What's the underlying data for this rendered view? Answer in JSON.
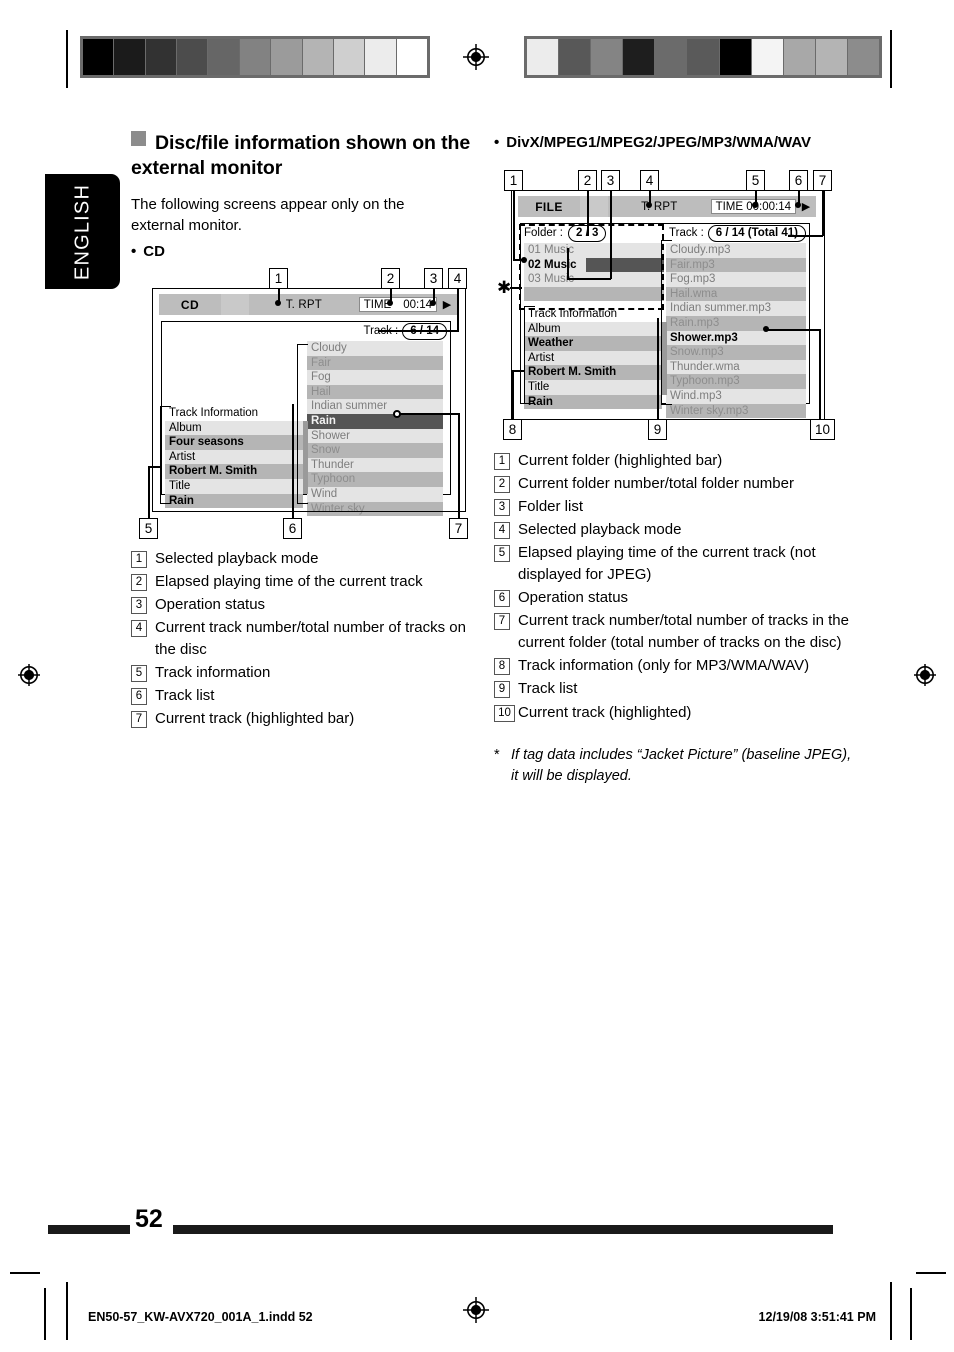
{
  "page": {
    "language_tab": "ENGLISH",
    "number": "52",
    "footer_file": "EN50-57_KW-AVX720_001A_1.indd   52",
    "footer_date": "12/19/08   3:51:41 PM"
  },
  "section": {
    "title": "Disc/file information shown on the external monitor",
    "intro": "The following screens appear only on the external monitor.",
    "cd_label": "CD",
    "divx_label": "DivX/MPEG1/MPEG2/JPEG/MP3/WMA/WAV",
    "bullet": "•"
  },
  "cd_screen": {
    "source": "CD",
    "mode": "T. RPT",
    "time_label": "TIME",
    "time_value": "00:14",
    "play_icon": "▶",
    "track_label": "Track :",
    "track_value": "6 / 14",
    "info_title": "Track Information",
    "info_rows": [
      {
        "key": "Album",
        "value": "Four seasons"
      },
      {
        "key": "Artist",
        "value": "Robert M. Smith"
      },
      {
        "key": "Title",
        "value": "Rain"
      }
    ],
    "tracks": [
      "Cloudy",
      "Fair",
      "Fog",
      "Hail",
      "Indian summer",
      "Rain",
      "Shower",
      "Snow",
      "Thunder",
      "Typhoon",
      "Wind",
      "Winter sky"
    ],
    "selected_track_index": 5,
    "callouts": [
      "1",
      "2",
      "3",
      "4",
      "5",
      "6",
      "7"
    ]
  },
  "divx_screen": {
    "source": "FILE",
    "mode": "T. RPT",
    "time_label": "TIME 00:00:14",
    "play_icon": "▶",
    "folder_label": "Folder :",
    "folder_value": "2 / 3",
    "track_label": "Track :",
    "track_value": "6 / 14 (Total 41)",
    "folders": [
      "01 Music",
      "02 Music",
      "03 Music",
      ""
    ],
    "selected_folder_index": 1,
    "info_title": "Track Information",
    "info_rows": [
      {
        "key": "Album",
        "value": "Weather"
      },
      {
        "key": "Artist",
        "value": "Robert M. Smith"
      },
      {
        "key": "Title",
        "value": "Rain"
      }
    ],
    "tracks": [
      "Cloudy.mp3",
      "Fair.mp3",
      "Fog.mp3",
      "Hail.wma",
      "Indian summer.mp3",
      "Rain.mp3",
      "Shower.mp3",
      "Snow.mp3",
      "Thunder.wma",
      "Typhoon.mp3",
      "Wind.mp3",
      "Winter sky.mp3"
    ],
    "selected_track_index": 6,
    "callouts": [
      "1",
      "2",
      "3",
      "4",
      "5",
      "6",
      "7",
      "8",
      "9",
      "10"
    ],
    "jacket_star": "✱"
  },
  "legend_cd": [
    {
      "n": "1",
      "text": "Selected playback mode"
    },
    {
      "n": "2",
      "text": "Elapsed playing time of the current track"
    },
    {
      "n": "3",
      "text": "Operation status"
    },
    {
      "n": "4",
      "text": "Current track number/total number of tracks on the disc"
    },
    {
      "n": "5",
      "text": "Track information"
    },
    {
      "n": "6",
      "text": "Track list"
    },
    {
      "n": "7",
      "text": "Current track (highlighted bar)"
    }
  ],
  "legend_divx": [
    {
      "n": "1",
      "text": "Current folder (highlighted bar)"
    },
    {
      "n": "2",
      "text": "Current folder number/total folder number"
    },
    {
      "n": "3",
      "text": "Folder list"
    },
    {
      "n": "4",
      "text": "Selected playback mode"
    },
    {
      "n": "5",
      "text": "Elapsed playing time of the current track (not displayed for JPEG)"
    },
    {
      "n": "6",
      "text": "Operation status"
    },
    {
      "n": "7",
      "text": "Current track number/total number of tracks in the current folder (total number of tracks on the disc)"
    },
    {
      "n": "8",
      "text": "Track information (only for MP3/WMA/WAV)"
    },
    {
      "n": "9",
      "text": "Track list"
    },
    {
      "n": "10",
      "text": "Current track (highlighted)"
    }
  ],
  "footnote": {
    "marker": "*",
    "text": "If tag data includes “Jacket Picture” (baseline JPEG), it will be displayed."
  },
  "calibration": {
    "left_swatches": [
      "#000000",
      "#1b1b1b",
      "#323232",
      "#4c4c4c",
      "#666666",
      "#828282",
      "#9b9b9b",
      "#b4b4b4",
      "#cfcfcf",
      "#ececec",
      "#ffffff"
    ],
    "right_swatches": [
      "#ececec",
      "#585858",
      "#848484",
      "#1e1e1e",
      "#6b6b6b",
      "#5a5a5a",
      "#000000",
      "#f4f4f4",
      "#a8a8a8",
      "#b4b4b4",
      "#8c8c8c"
    ]
  }
}
